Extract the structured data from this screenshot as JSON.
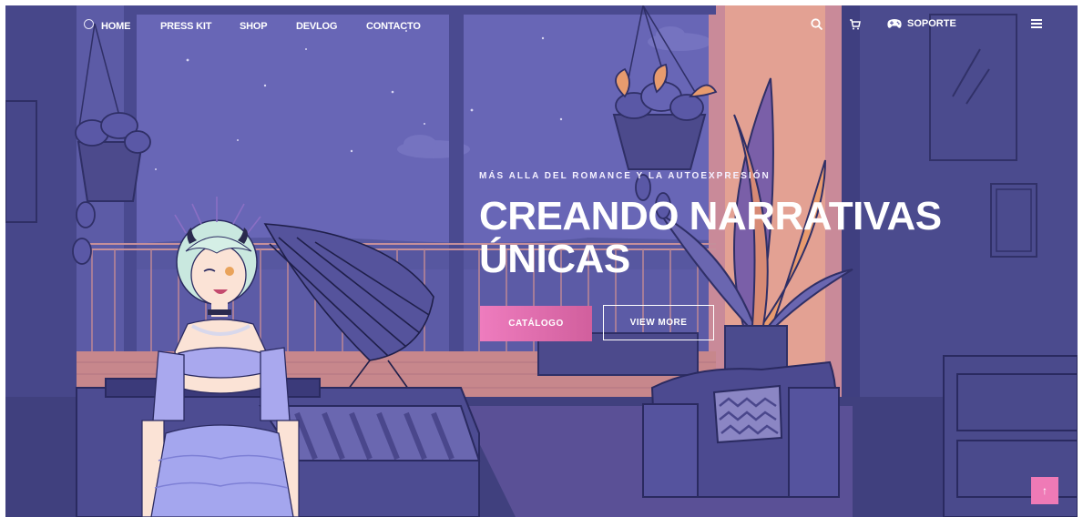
{
  "nav": {
    "links": [
      "HOME",
      "PRESS KIT",
      "SHOP",
      "DEVLOG",
      "CONTACTO"
    ],
    "soporte_label": "SOPORTE",
    "icons": [
      "search-icon",
      "cart-icon",
      "gamepad-icon",
      "menu-icon"
    ]
  },
  "hero": {
    "kicker": "MÁS ALLA DEL ROMANCE Y LA AUTOEXPRESIÓN",
    "headline_line1": "CREANDO NARRATIVAS",
    "headline_line2": "ÚNICAS",
    "catalog_button": "CATÁLOGO",
    "view_more_button": "VIEW MORE"
  },
  "scroll_top_icon": "↑",
  "colors": {
    "night_sky": "#6664b4",
    "wall": "#4a4a8c",
    "accent_pink": "#ee7cbe",
    "warm_glow": "#e8a08a"
  }
}
